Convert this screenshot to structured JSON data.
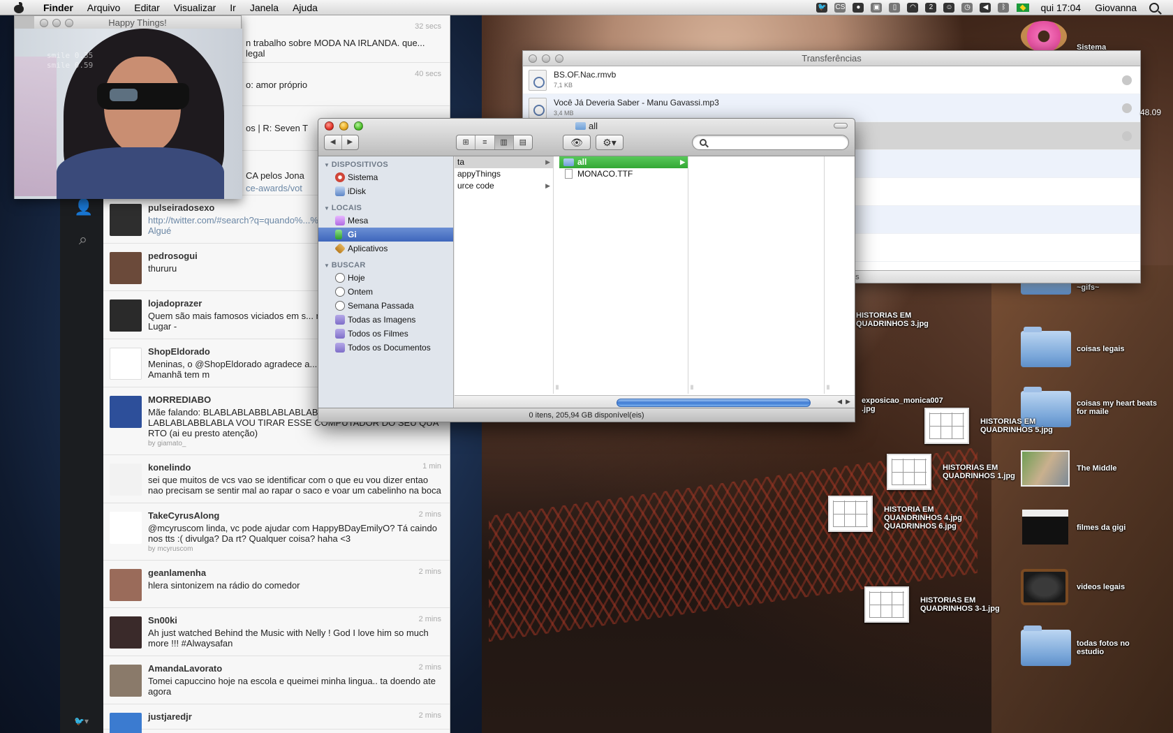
{
  "menubar": {
    "items": [
      "Finder",
      "Arquivo",
      "Editar",
      "Visualizar",
      "Ir",
      "Janela",
      "Ajuda"
    ],
    "status_cs": "CS",
    "clock": "qui 17:04",
    "user": "Giovanna"
  },
  "webcam_window": {
    "title": "Happy Things!",
    "overlay_line1": "smile   0.35",
    "overlay_line2": "smile   0.59"
  },
  "twitter": {
    "partial_top": [
      {
        "time": "32 secs",
        "text": "n trabalho sobre MODA NA IRLANDA. que... legal"
      },
      {
        "time": "40 secs",
        "text": "o: amor próprio"
      },
      {
        "text": "os | R: Seven T"
      },
      {
        "text": "CA pelos Jona",
        "link": "ce-awards/vot"
      }
    ],
    "tweets": [
      {
        "user": "pulseiradosexo",
        "time": "",
        "text": "http://twitter.com/#search?q=quando%...%20simplesmente%20dinheiro Algué",
        "link": true,
        "avatar": "#2e2e2e"
      },
      {
        "user": "pedrosogui",
        "time": "",
        "text": "thururu",
        "avatar": "#6b4a3a"
      },
      {
        "user": "lojadoprazer",
        "time": "",
        "text": "Quem são mais famosos viciados em s... mundo das celebridades tb! 6º Lugar -",
        "avatar": "#2a2a2a"
      },
      {
        "user": "ShopEldorado",
        "time": "",
        "text": "Meninas, o @ShopEldorado agradece a... as ganhadoras de hoje! Amanhã tem m",
        "avatar": "#ffffff"
      },
      {
        "user": "MORREDIABO",
        "time": "",
        "text": "Mãe falando: BLABLABLABBLABLABLABBLABLABLABBLABLABLABBLABLABLABBLABLA VOU TIRAR ESSE COMPUTADOR DO SEU QUARTO (ai eu presto atenção)",
        "rt": "by giamato_",
        "avatar": "#2d4f9a"
      },
      {
        "user": "konelindo",
        "time": "1 min",
        "text": "sei que muitos de vcs vao se identificar com o que eu vou dizer entao nao precisam se sentir mal ao rapar o saco e voar um cabelinho na boca",
        "avatar": "#f2f2f2"
      },
      {
        "user": "TakeCyrusAlong",
        "time": "2 mins",
        "text": "@mcyruscom linda, vc pode ajudar com HappyBDayEmilyO? Tá caindo nos tts :( divulga? Da rt? Qualquer coisa? haha <3",
        "rt": "by mcyruscom",
        "avatar": "#ffffff"
      },
      {
        "user": "geanlamenha",
        "time": "2 mins",
        "text": "hlera sintonizem na rádio do comedor",
        "avatar": "#9a6b5a"
      },
      {
        "user": "Sn00ki",
        "time": "2 mins",
        "text": "Ah just watched Behind the Music with Nelly ! God I love him so much more !!! #Alwaysafan",
        "avatar": "#3a2a2a"
      },
      {
        "user": "AmandaLavorato",
        "time": "2 mins",
        "text": "Tomei capuccino hoje na escola e queimei minha lingua.. ta doendo ate agora",
        "avatar": "#8a7a6a"
      },
      {
        "user": "justjaredjr",
        "time": "2 mins",
        "text": "",
        "avatar": "#3b7bd0"
      }
    ]
  },
  "transfers": {
    "title": "Transferências",
    "rows": [
      {
        "name": "BS.OF.Nac.rmvb",
        "size": "7,1 KB"
      },
      {
        "name": "Você Já Deveria Saber - Manu Gavassi.mp3",
        "size": "3,4 MB"
      },
      {
        "name": "",
        "size": ""
      },
      {
        "name": "",
        "size": ""
      },
      {
        "name": "",
        "size": ""
      },
      {
        "name": "",
        "size": ""
      },
      {
        "name": "",
        "size": ""
      }
    ],
    "side_text": "48.09",
    "bottom_text": "as"
  },
  "finder": {
    "title": "all",
    "search_placeholder": "",
    "nav_back": "◀",
    "nav_forward": "▶",
    "views": [
      "⊞",
      "≡",
      "▥",
      "▤"
    ],
    "eye": "👁",
    "gear": "⚙▾",
    "sections": [
      {
        "header": "DISPOSITIVOS",
        "items": [
          {
            "label": "Sistema",
            "icon": "hd-icon"
          },
          {
            "label": "iDisk",
            "icon": "idisk-icon"
          }
        ]
      },
      {
        "header": "LOCAIS",
        "items": [
          {
            "label": "Mesa",
            "icon": "desktop-icon"
          },
          {
            "label": "Gi",
            "icon": "home-icon",
            "selected": true
          },
          {
            "label": "Aplicativos",
            "icon": "apps-icon"
          }
        ]
      },
      {
        "header": "BUSCAR",
        "items": [
          {
            "label": "Hoje",
            "icon": "clock-icon"
          },
          {
            "label": "Ontem",
            "icon": "clock-icon"
          },
          {
            "label": "Semana Passada",
            "icon": "clock-icon"
          },
          {
            "label": "Todas as Imagens",
            "icon": "smart-folder-icon"
          },
          {
            "label": "Todos os Filmes",
            "icon": "smart-folder-icon"
          },
          {
            "label": "Todos os Documentos",
            "icon": "smart-folder-icon"
          }
        ]
      }
    ],
    "column1": [
      {
        "label": "ta",
        "arrow": "▶",
        "selected": true
      },
      {
        "label": "appyThings",
        "arrow": ""
      },
      {
        "label": "urce code",
        "arrow": "▶"
      }
    ],
    "column2": [
      {
        "label": "all",
        "arrow": "▶",
        "selected": true
      },
      {
        "label": "MONACO.TTF",
        "arrow": ""
      }
    ],
    "status": "0 itens, 205,94 GB disponível(eis)"
  },
  "desktop_icons": [
    {
      "label": "Sistema",
      "kind": "donut"
    },
    {
      "label": "~gifs~",
      "kind": "folder"
    },
    {
      "label": "coisas legais",
      "kind": "folder"
    },
    {
      "label": "coisas my heart beats\nfor maile",
      "kind": "folder"
    },
    {
      "label": "The Middle",
      "kind": "photo"
    },
    {
      "label": "filmes da gigi",
      "kind": "clapper"
    },
    {
      "label": "videos legais",
      "kind": "tv"
    },
    {
      "label": "todas fotos no\nestudio",
      "kind": "folder"
    },
    {
      "label": "HISTORIAS EM\nQUADRINHOS 3.jpg",
      "kind": "label"
    },
    {
      "label": "exposicao_monica007\n.jpg",
      "kind": "label"
    },
    {
      "label": "HISTORIAS EM\nQUADRINHOS 5.jpg",
      "kind": "comic"
    },
    {
      "label": "HISTORIAS EM\nQUADRINHOS 1.jpg",
      "kind": "comic"
    },
    {
      "label": "HISTORIA EM\nQUANDRINHOS 4.jpg\nQUADRINHOS 6.jpg",
      "kind": "comic"
    },
    {
      "label": "HISTORIAS EM\nQUADRINHOS 3-1.jpg",
      "kind": "comic"
    }
  ]
}
